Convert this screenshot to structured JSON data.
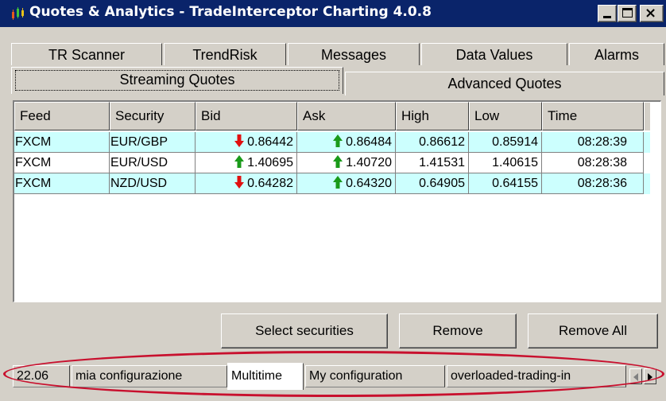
{
  "window": {
    "title": "Quotes & Analytics - TradeInterceptor Charting 4.0.8",
    "controls": {
      "close_glyph": "×"
    }
  },
  "tabs_row1": [
    "TR Scanner",
    "TrendRisk",
    "Messages",
    "Data Values",
    "Alarms"
  ],
  "tabs_row2": [
    "Streaming Quotes",
    "Advanced Quotes"
  ],
  "active_tab": "Streaming Quotes",
  "table": {
    "columns": [
      "Feed",
      "Security",
      "Bid",
      "Ask",
      "High",
      "Low",
      "Time"
    ],
    "rows": [
      {
        "feed": "FXCM",
        "security": "EUR/GBP",
        "bid": "0.86442",
        "bid_dir": "down",
        "ask": "0.86484",
        "ask_dir": "up",
        "high": "0.86612",
        "low": "0.85914",
        "time": "08:28:39"
      },
      {
        "feed": "FXCM",
        "security": "EUR/USD",
        "bid": "1.40695",
        "bid_dir": "up",
        "ask": "1.40720",
        "ask_dir": "up",
        "high": "1.41531",
        "low": "1.40615",
        "time": "08:28:38"
      },
      {
        "feed": "FXCM",
        "security": "NZD/USD",
        "bid": "0.64282",
        "bid_dir": "down",
        "ask": "0.64320",
        "ask_dir": "up",
        "high": "0.64905",
        "low": "0.64155",
        "time": "08:28:36"
      }
    ],
    "row_colors": {
      "highlight": "#ccfffe",
      "plain": "#ffffff"
    },
    "arrow_colors": {
      "up": "#1a9a1a",
      "down": "#e01010"
    }
  },
  "buttons": {
    "select_securities": "Select securities",
    "remove": "Remove",
    "remove_all": "Remove All"
  },
  "workspace_tabs": [
    "22.06",
    "mia configurazione",
    "Multitime",
    "My configuration",
    "overloaded-trading-in"
  ],
  "selected_workspace": "Multitime",
  "colors": {
    "titlebar": "#0a246a",
    "face": "#d4d0c8",
    "highlight_oval": "#c8102e"
  }
}
